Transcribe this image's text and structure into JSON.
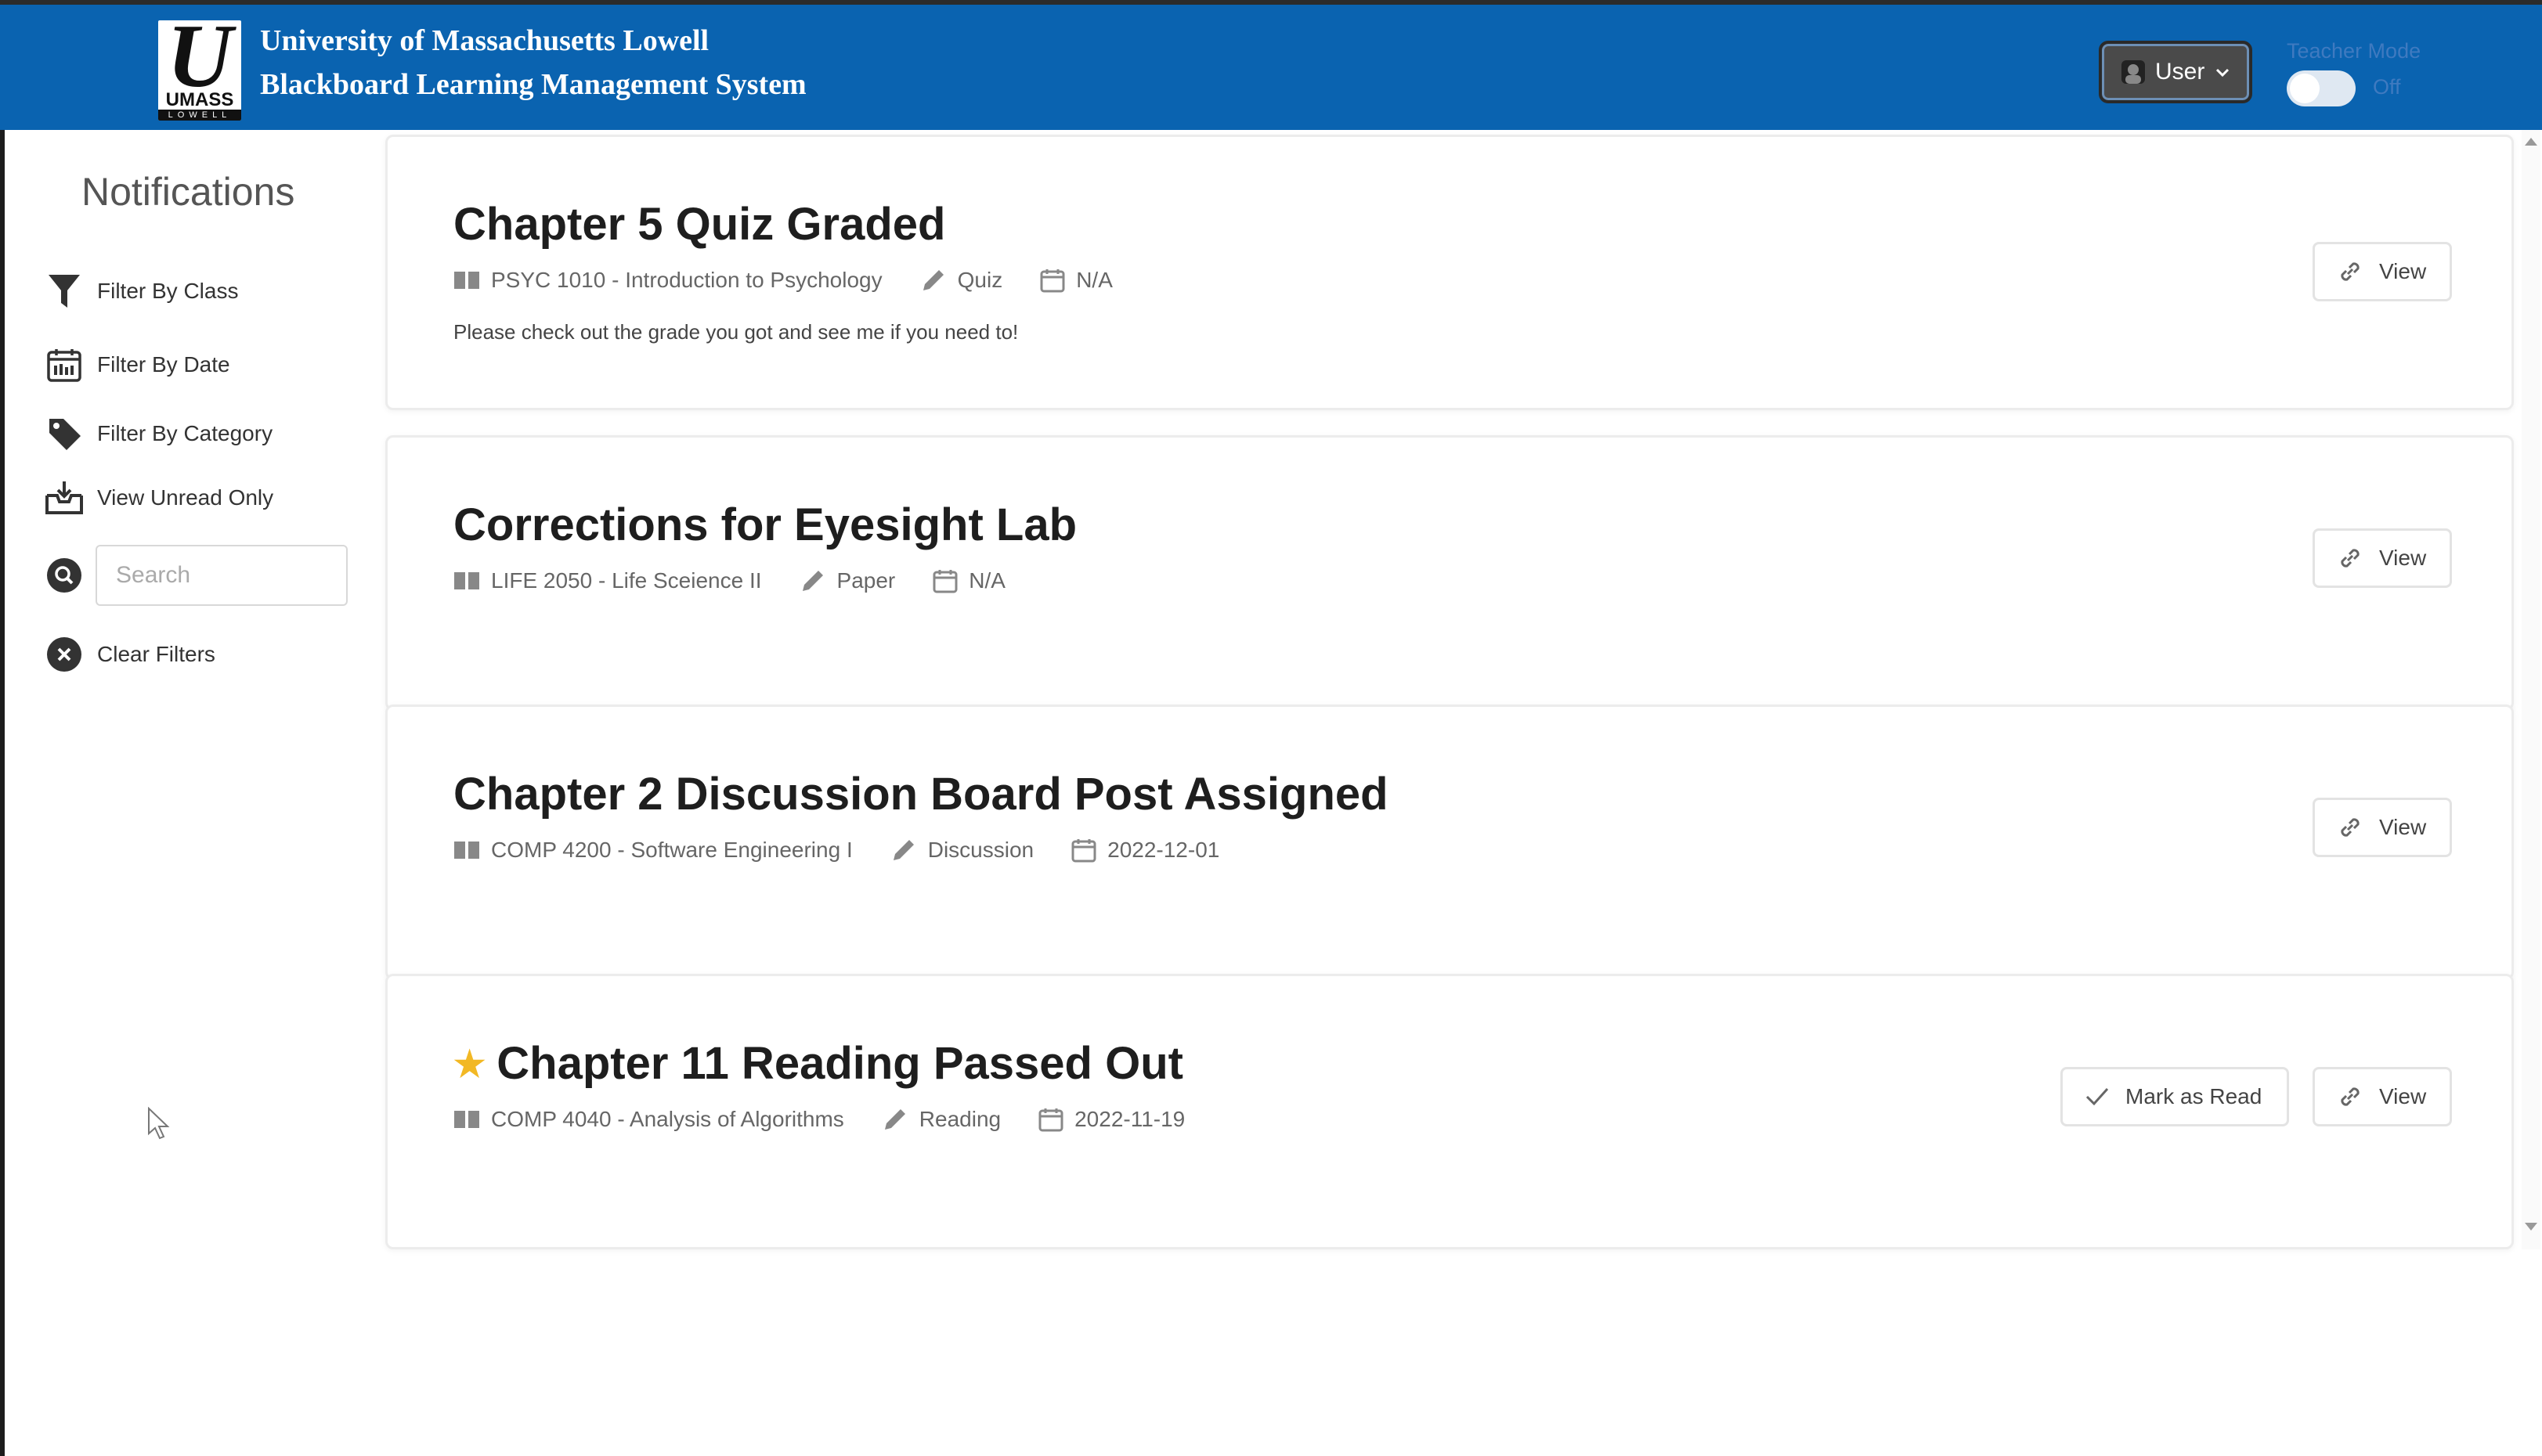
{
  "header": {
    "title_line1": "University of Massachusetts Lowell",
    "title_line2": "Blackboard Learning Management System",
    "logo_text": "UMASS",
    "logo_subtext": "LOWELL",
    "user_label": "User",
    "teacher_mode_label": "Teacher Mode",
    "teacher_mode_state": "Off",
    "brand_color": "#0a63b0"
  },
  "sidebar": {
    "title": "Notifications",
    "items": [
      {
        "label": "Filter By Class",
        "icon": "funnel-icon"
      },
      {
        "label": "Filter By Date",
        "icon": "calendar-icon"
      },
      {
        "label": "Filter By Category",
        "icon": "tag-icon"
      },
      {
        "label": "View Unread Only",
        "icon": "inbox-icon"
      }
    ],
    "search_placeholder": "Search",
    "clear_label": "Clear Filters"
  },
  "notifications": [
    {
      "title": "Chapter 5 Quiz Graded",
      "course": "PSYC 1010 - Introduction to Psychology",
      "category": "Quiz",
      "date": "N/A",
      "message": "Please check out the grade you got and see me if you need to!",
      "starred": false,
      "view_label": "View"
    },
    {
      "title": "Corrections for Eyesight Lab",
      "course": "LIFE 2050 - Life Sceience II",
      "category": "Paper",
      "date": "N/A",
      "starred": false,
      "view_label": "View"
    },
    {
      "title": "Chapter 2 Discussion Board Post Assigned",
      "course": "COMP 4200 - Software Engineering I",
      "category": "Discussion",
      "date": "2022-12-01",
      "starred": false,
      "view_label": "View"
    },
    {
      "title": "Chapter 11 Reading Passed Out",
      "course": "COMP 4040 - Analysis of Algorithms",
      "category": "Reading",
      "date": "2022-11-19",
      "starred": true,
      "mark_read_label": "Mark as Read",
      "view_label": "View"
    }
  ]
}
